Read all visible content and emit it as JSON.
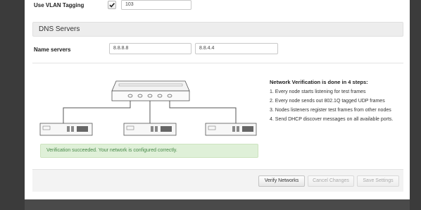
{
  "vlan": {
    "label": "Use VLAN Tagging",
    "checked": true,
    "value": "103"
  },
  "dns": {
    "section_title": "DNS Servers",
    "label": "Name servers",
    "servers": [
      "8.8.8.8",
      "8.8.4.4"
    ]
  },
  "verification": {
    "title": "Network Verification is done in 4 steps:",
    "steps": [
      "1. Every node starts listening for test frames",
      "2. Every node sends out 802.1Q tagged UDP frames",
      "3. Nodes listeners register test frames from other nodes",
      "4. Send DHCP discover messages on all available ports."
    ],
    "success_message": "Verification succeeded. Your network is configured correctly."
  },
  "buttons": {
    "verify": "Verify Networks",
    "cancel": "Cancel Changes",
    "save": "Save Settings"
  },
  "colors": {
    "success_bg": "#dff0d8",
    "success_text": "#468847",
    "section_bg": "#ededed",
    "backdrop": "#3b3b3b"
  }
}
